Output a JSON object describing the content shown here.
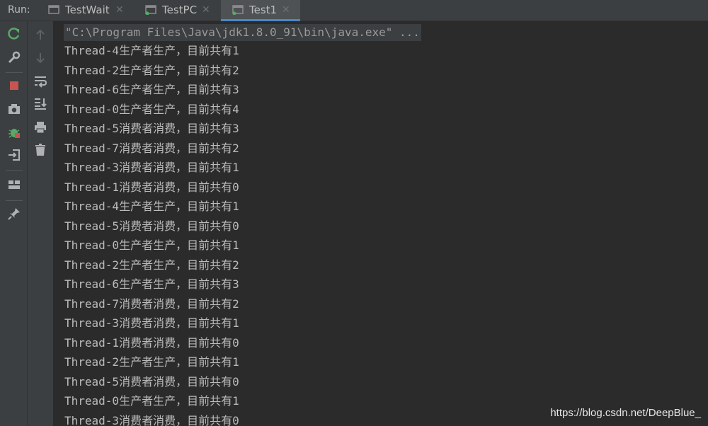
{
  "run_label": "Run:",
  "tabs": [
    {
      "label": "TestWait",
      "active": false
    },
    {
      "label": "TestPC",
      "active": false
    },
    {
      "label": "Test1",
      "active": true
    }
  ],
  "left_toolbar_icons": [
    "rerun-icon",
    "settings-wrench-icon",
    "stop-icon",
    "camera-icon",
    "debug-bug-icon",
    "exit-icon",
    "layout-icon",
    "pin-icon"
  ],
  "right_toolbar_icons": [
    "up-arrow-icon",
    "down-arrow-icon",
    "soft-wrap-icon",
    "scroll-to-end-icon",
    "print-icon",
    "trash-icon"
  ],
  "console": {
    "command": "\"C:\\Program Files\\Java\\jdk1.8.0_91\\bin\\java.exe\" ...",
    "lines": [
      "Thread-4生产者生产，目前共有1",
      "Thread-2生产者生产，目前共有2",
      "Thread-6生产者生产，目前共有3",
      "Thread-0生产者生产，目前共有4",
      "Thread-5消费者消费，目前共有3",
      "Thread-7消费者消费，目前共有2",
      "Thread-3消费者消费，目前共有1",
      "Thread-1消费者消费，目前共有0",
      "Thread-4生产者生产，目前共有1",
      "Thread-5消费者消费，目前共有0",
      "Thread-0生产者生产，目前共有1",
      "Thread-2生产者生产，目前共有2",
      "Thread-6生产者生产，目前共有3",
      "Thread-7消费者消费，目前共有2",
      "Thread-3消费者消费，目前共有1",
      "Thread-1消费者消费，目前共有0",
      "Thread-2生产者生产，目前共有1",
      "Thread-5消费者消费，目前共有0",
      "Thread-0生产者生产，目前共有1",
      "Thread-3消费者消费，目前共有0"
    ]
  },
  "watermark": "https://blog.csdn.net/DeepBlue_"
}
